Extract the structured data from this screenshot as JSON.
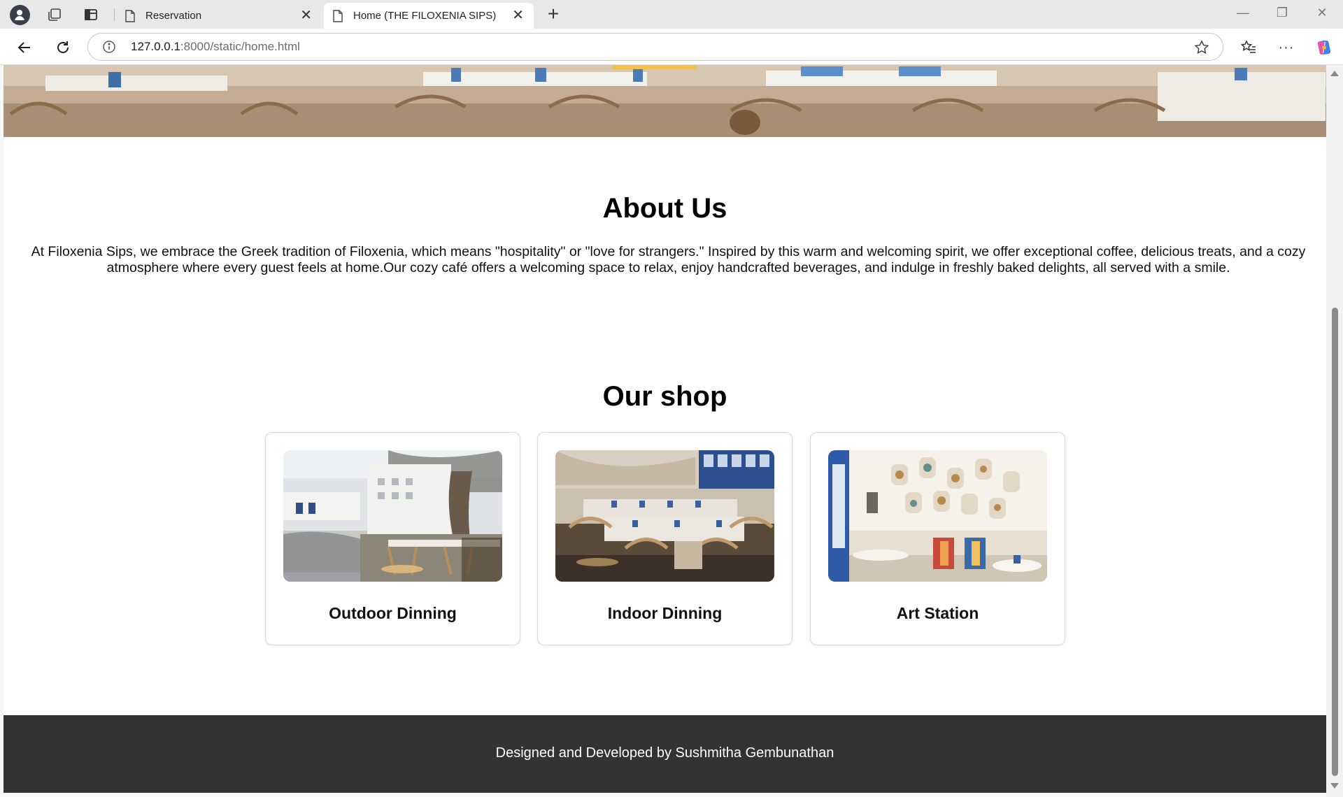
{
  "browser": {
    "tabs": [
      {
        "title": "Reservation",
        "active": false
      },
      {
        "title": "Home (THE FILOXENIA SIPS)",
        "active": true
      }
    ],
    "new_tab_label": "+",
    "url_host": "127.0.0.1",
    "url_rest": ":8000/static/home.html",
    "more_label": "···",
    "icons": {
      "profile": "profile-avatar-icon",
      "workspaces": "workspaces-icon",
      "vertical_tabs": "vertical-tabs-icon",
      "page": "page-icon",
      "close": "close-icon",
      "back": "back-arrow-icon",
      "reload": "reload-icon",
      "info": "info-icon",
      "favorite": "star-icon",
      "favorites": "favorites-icon",
      "more": "more-icon",
      "copilot": "copilot-icon"
    }
  },
  "page": {
    "about": {
      "title": "About Us",
      "text": "At Filoxenia Sips, we embrace the Greek tradition of Filoxenia, which means \"hospitality\" or \"love for strangers.\" Inspired by this warm and welcoming spirit, we offer exceptional coffee, delicious treats, and a cozy atmosphere where every guest feels at home.Our cozy café offers a welcoming space to relax, enjoy handcrafted beverages, and indulge in freshly baked delights, all served with a smile."
    },
    "shop": {
      "title": "Our shop",
      "cards": [
        {
          "label": "Outdoor Dinning"
        },
        {
          "label": "Indoor Dinning"
        },
        {
          "label": "Art Station"
        }
      ]
    },
    "footer": {
      "credit": "Designed and Developed by Sushmitha Gembunathan",
      "background": "#333333"
    }
  }
}
